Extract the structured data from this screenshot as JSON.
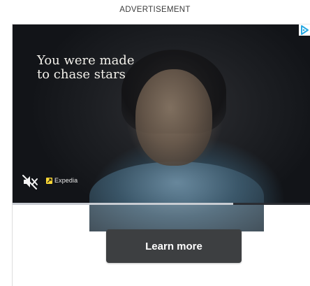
{
  "header": {
    "label": "ADVERTISEMENT"
  },
  "ad": {
    "headline": "You were made\nto chase stars",
    "brand_name": "Expedia",
    "video_progress": 0.74,
    "cta_label": "Learn more",
    "icons": {
      "mute": "speaker-muted-icon",
      "brand": "expedia-logo-icon",
      "adchoices": "adchoices-icon"
    },
    "colors": {
      "cta_background": "#3d3f41",
      "brand_logo": "#fdd835",
      "adchoices": "#29a9e1"
    }
  }
}
